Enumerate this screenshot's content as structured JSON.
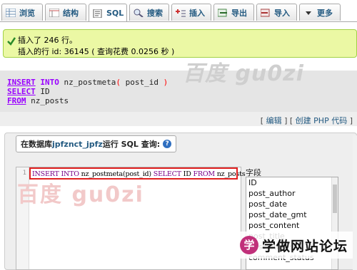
{
  "tabs": [
    {
      "label": "浏览",
      "icon": "browse-icon"
    },
    {
      "label": "结构",
      "icon": "structure-icon"
    },
    {
      "label": "SQL",
      "icon": "sql-icon",
      "active": true
    },
    {
      "label": "搜索",
      "icon": "search-icon"
    },
    {
      "label": "插入",
      "icon": "insert-icon"
    },
    {
      "label": "导出",
      "icon": "export-icon"
    },
    {
      "label": "导入",
      "icon": "import-icon"
    },
    {
      "label": "更多",
      "icon": "chevron-down-icon"
    }
  ],
  "success": {
    "line1": "插入了 246 行。",
    "line2": "插入的行 id: 36145 ( 查询花费 0.0256 秒 )"
  },
  "sql_display": {
    "kw_insert": "INSERT",
    "kw_into": " INTO",
    "table": " nz_postmeta",
    "open_paren": "(",
    "column": " post_id ",
    "close_paren": ")",
    "kw_select": "SELECT",
    "select_col": " ID",
    "kw_from": "FROM",
    "from_table": " nz_posts"
  },
  "watermark_top": "百度 gu0zi",
  "links": {
    "open": "[ ",
    "edit": "编辑",
    "sep": " ] [ ",
    "create_php": "创建 PHP 代码",
    "close": " ]"
  },
  "query_panel": {
    "legend_prefix": "在数据库 ",
    "db_name": "jpfznct_jpfz",
    "legend_suffix": " 运行 SQL 查询:",
    "help": "?"
  },
  "editor": {
    "line_number": "1",
    "code_kw1": "INSERT INTO ",
    "code_tbl": "nz_postmeta",
    "code_col": "(post_id)",
    "code_kw2": " SELECT ",
    "code_id": "ID",
    "code_kw3": " FROM ",
    "code_from": "nz_posts"
  },
  "watermark_editor": "百度 gu0zi",
  "fields": {
    "label": "字段",
    "options": [
      "ID",
      "post_author",
      "post_date",
      "post_date_gmt",
      "post_content",
      "post_title",
      "post_status",
      "comment_status"
    ]
  },
  "badge": {
    "circle": "学",
    "text": "学做网站论坛"
  },
  "colors": {
    "accent": "#235a81",
    "success_bg": "#ebf8a4",
    "keyword": "#9900ff",
    "highlight": "#e02020"
  }
}
